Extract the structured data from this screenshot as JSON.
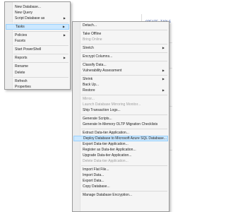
{
  "editor": {
    "code_snippet": "CREATE TABLE"
  },
  "main_menu": {
    "items": [
      {
        "label": "New Database..."
      },
      {
        "label": "New Query"
      },
      {
        "label": "Script Database as",
        "arrow": "▶"
      },
      {
        "label": "Tasks",
        "arrow": "▶",
        "highlighted": true
      },
      {
        "label": "Policies",
        "arrow": "▶"
      },
      {
        "label": "Facets"
      },
      {
        "label": "Start PowerShell"
      },
      {
        "label": "Reports",
        "arrow": "▶"
      },
      {
        "label": "Rename"
      },
      {
        "label": "Delete"
      },
      {
        "label": "Refresh"
      },
      {
        "label": "Properties"
      }
    ]
  },
  "tasks_menu": {
    "items": [
      {
        "label": "Detach..."
      },
      {
        "label": "Take Offline"
      },
      {
        "label": "Bring Online",
        "disabled": true
      },
      {
        "label": "Stretch",
        "arrow": "▶"
      },
      {
        "label": "Encrypt Columns..."
      },
      {
        "label": "Classify Data..."
      },
      {
        "label": "Vulnerability Assessment",
        "arrow": "▶"
      },
      {
        "label": "Shrink",
        "arrow": "▶"
      },
      {
        "label": "Back Up..."
      },
      {
        "label": "Restore",
        "arrow": "▶"
      },
      {
        "label": "Mirror...",
        "disabled": true
      },
      {
        "label": "Launch Database Mirroring Monitor...",
        "disabled": true
      },
      {
        "label": "Ship Transaction Logs..."
      },
      {
        "label": "Generate Scripts..."
      },
      {
        "label": "Generate In-Memory OLTP Migration Checklists"
      },
      {
        "label": "Extract Data-tier Application..."
      },
      {
        "label": "Deploy Database to Microsoft Azure SQL Database...",
        "highlighted": true
      },
      {
        "label": "Export Data-tier Application..."
      },
      {
        "label": "Register as Data-tier Application..."
      },
      {
        "label": "Upgrade Data-tier Application..."
      },
      {
        "label": "Delete Data-tier Application...",
        "disabled": true
      },
      {
        "label": "Import Flat File..."
      },
      {
        "label": "Import Data..."
      },
      {
        "label": "Export Data..."
      },
      {
        "label": "Copy Database..."
      },
      {
        "label": "Manage Database Encryption..."
      }
    ]
  }
}
